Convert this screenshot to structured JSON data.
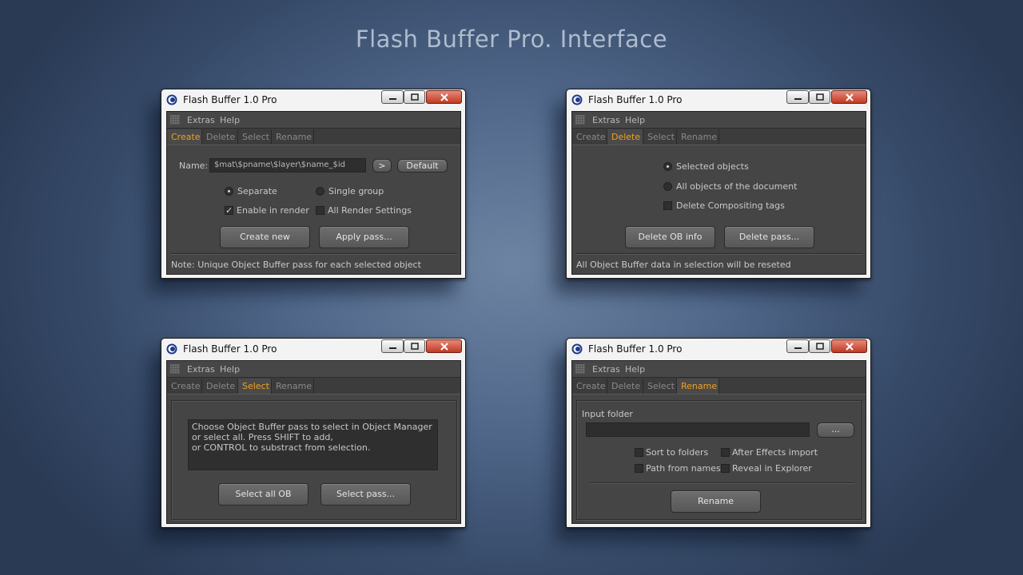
{
  "page_title": "Flash Buffer Pro. Interface",
  "window_title": "Flash Buffer 1.0 Pro",
  "menu": {
    "extras": "Extras",
    "help": "Help"
  },
  "tabs": {
    "create": "Create",
    "delete": "Delete",
    "select": "Select",
    "rename": "Rename"
  },
  "colors": {
    "accent": "#f0a020",
    "panel": "#454545",
    "close_button": "#c13a22"
  },
  "create_window": {
    "name_label": "Name:",
    "name_value": "$mat\\$pname\\$layer\\$name_$id",
    "arrow_button": ">",
    "default_button": "Default",
    "separate": "Separate",
    "single_group": "Single group",
    "enable_render": "Enable in render",
    "all_render_settings": "All Render Settings",
    "create_new": "Create new",
    "apply_pass": "Apply pass...",
    "note": "Note: Unique Object Buffer pass for each selected object"
  },
  "delete_window": {
    "selected_objects": "Selected objects",
    "all_objects": "All objects of the document",
    "delete_compositing": "Delete Compositing tags",
    "delete_ob_info": "Delete OB info",
    "delete_pass": "Delete pass...",
    "note": "All Object Buffer data in selection will be reseted"
  },
  "select_window": {
    "info_line1": "Choose Object Buffer pass to select in Object Manager",
    "info_line2": "or select all. Press SHIFT to add,",
    "info_line3": "or CONTROL to substract from selection.",
    "select_all": "Select all OB",
    "select_pass": "Select pass..."
  },
  "rename_window": {
    "input_folder": "Input folder",
    "browse": "...",
    "sort_to_folders": "Sort to folders",
    "after_effects": "After Effects import",
    "path_from_names": "Path from names",
    "reveal_explorer": "Reveal in Explorer",
    "rename_button": "Rename"
  }
}
